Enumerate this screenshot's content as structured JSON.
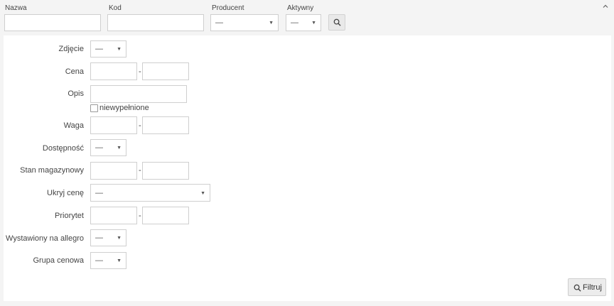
{
  "top_filters": {
    "name_label": "Nazwa",
    "code_label": "Kod",
    "producer_label": "Producent",
    "producer_value": "—",
    "active_label": "Aktywny",
    "active_value": "—"
  },
  "advanced": {
    "photo_label": "Zdjęcie",
    "photo_value": "—",
    "price_label": "Cena",
    "description_label": "Opis",
    "unfilled_label": "niewypełnione",
    "weight_label": "Waga",
    "availability_label": "Dostępność",
    "availability_value": "—",
    "stock_label": "Stan magazynowy",
    "hide_price_label": "Ukryj cenę",
    "hide_price_value": "—",
    "priority_label": "Priorytet",
    "allegro_label": "Wystawiony na allegro",
    "allegro_value": "—",
    "price_group_label": "Grupa cenowa",
    "price_group_value": "—",
    "range_separator": "-"
  },
  "filter_button_label": "Filtruj",
  "icons": {
    "search": "search-icon",
    "collapse": "chevron-up-icon",
    "dropdown": "caret-down-icon"
  },
  "colors": {
    "border": "#cfcfcf",
    "button_bg": "#ececec",
    "page_bg": "#f4f4f4"
  }
}
